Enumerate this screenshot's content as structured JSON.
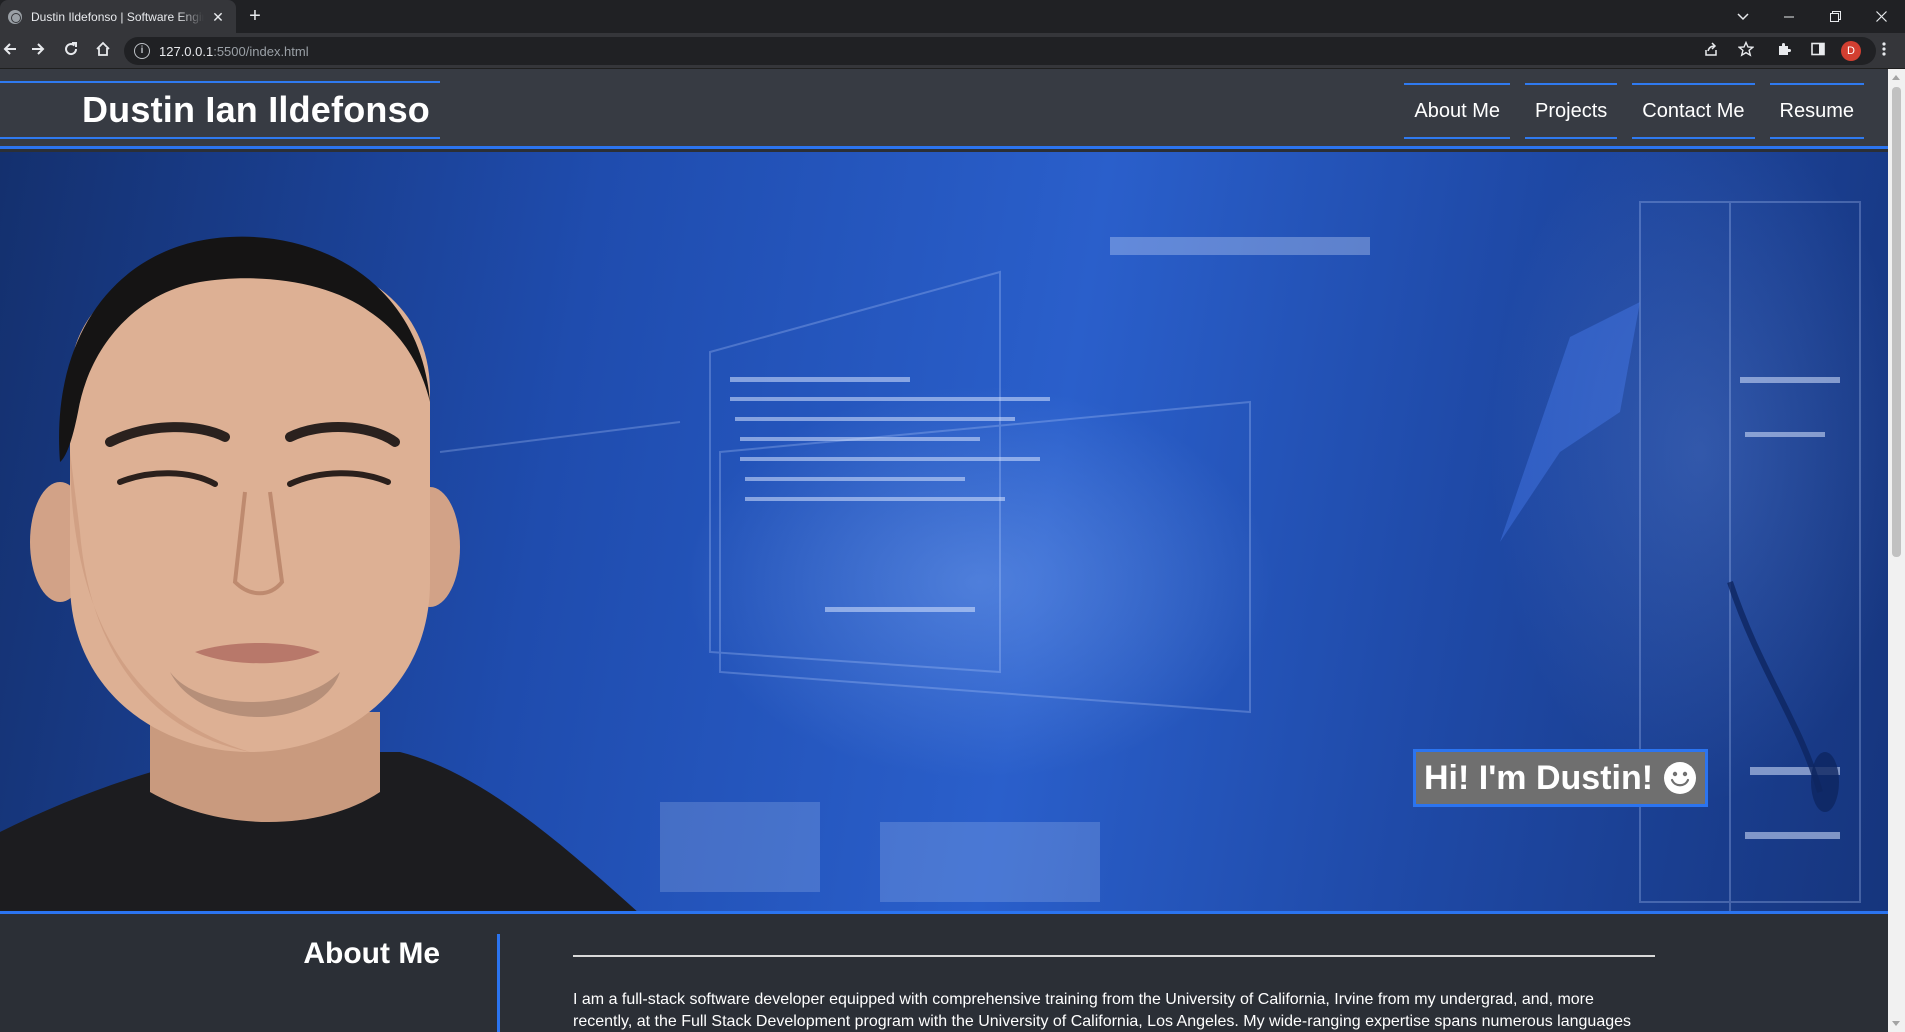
{
  "browser": {
    "tab_title": "Dustin Ildefonso | Software Engineer",
    "close_glyph": "✕",
    "new_tab_glyph": "+",
    "url_host": "127.0.0.1",
    "url_path": ":5500/index.html",
    "profile_initial": "D"
  },
  "site": {
    "name": "Dustin Ian Ildefonso",
    "nav": [
      "About Me",
      "Projects",
      "Contact Me",
      "Resume"
    ]
  },
  "hero": {
    "greeting": "Hi! I'm Dustin!"
  },
  "about": {
    "heading": "About Me",
    "paragraph": "I am a full-stack software developer equipped with comprehensive training from the University of California, Irvine from my undergrad, and, more recently, at the Full Stack Development program with the University of California, Los Angeles. My wide-ranging expertise spans numerous languages and"
  },
  "colors": {
    "accent": "#2b74f0",
    "header_bg": "#373b43",
    "page_bg": "#2b2f36",
    "greeting_bg": "#6f6f6f"
  }
}
